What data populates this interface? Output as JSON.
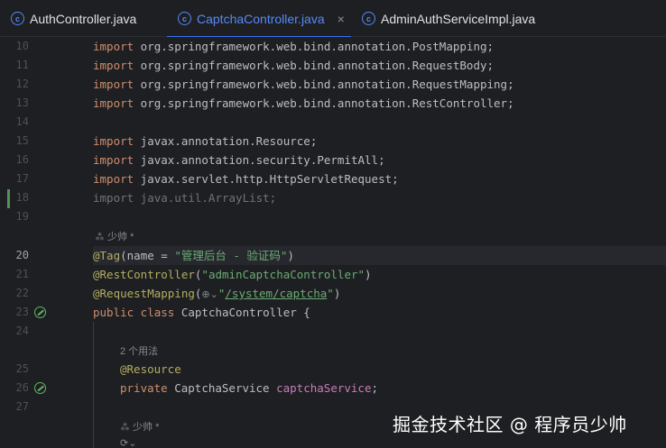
{
  "tabs": [
    {
      "label": "AuthController.java",
      "active": false
    },
    {
      "label": "CaptchaController.java",
      "active": true,
      "close": "×"
    },
    {
      "label": "AdminAuthServiceImpl.java",
      "active": false
    }
  ],
  "tab_icon_letter": "c",
  "code": {
    "l10_kw": "import",
    "l10_rest": " org.springframework.web.bind.annotation.PostMapping;",
    "l11_kw": "import",
    "l11_rest": " org.springframework.web.bind.annotation.RequestBody;",
    "l12_kw": "import",
    "l12_rest": " org.springframework.web.bind.annotation.RequestMapping;",
    "l13_kw": "import",
    "l13_rest": " org.springframework.web.bind.annotation.RestController;",
    "l15_kw": "import",
    "l15_rest": " javax.annotation.Resource;",
    "l16_kw": "import",
    "l16_rest": " javax.annotation.security.PermitAll;",
    "l17_kw": "import",
    "l17_rest": " javax.servlet.http.HttpServletRequest;",
    "l18": "import java.util.ArrayList;",
    "hint_author1": "⁂ 少帅 *",
    "l20_ann": "@Tag",
    "l20_p1": "(",
    "l20_param": "name",
    "l20_eq": " = ",
    "l20_str": "\"管理后台 - 验证码\"",
    "l20_p2": ")",
    "l21_ann": "@RestController",
    "l21_p1": "(",
    "l21_str": "\"adminCaptchaController\"",
    "l21_p2": ")",
    "l22_ann": "@RequestMapping",
    "l22_p1": "(",
    "l22_globe": "⊕⌄",
    "l22_q1": "\"",
    "l22_link": "/system/captcha",
    "l22_q2": "\"",
    "l22_p2": ")",
    "l23_kw": "public class",
    "l23_rest": " CaptchaController {",
    "hint_usages": "2 个用法",
    "l25_ann": "@Resource",
    "l26_kw": "private",
    "l26_type": " CaptchaService ",
    "l26_fld": "captchaService",
    "l26_end": ";",
    "hint_author2": "⁂ 少帅 *",
    "hint_symbol": "⟳⌄"
  },
  "line_numbers": {
    "n10": "10",
    "n11": "11",
    "n12": "12",
    "n13": "13",
    "n14": "14",
    "n15": "15",
    "n16": "16",
    "n17": "17",
    "n18": "18",
    "n19": "19",
    "n20": "20",
    "n21": "21",
    "n22": "22",
    "n23": "23",
    "n24": "24",
    "n25": "25",
    "n26": "26",
    "n27": "27"
  },
  "watermark": "掘金技术社区 @ 程序员少帅",
  "colors": {
    "background": "#1e1f22",
    "keyword": "#cf8e6d",
    "annotation": "#b3ae60",
    "string": "#6aab73",
    "field": "#c77dbb",
    "accent": "#3574f0"
  }
}
